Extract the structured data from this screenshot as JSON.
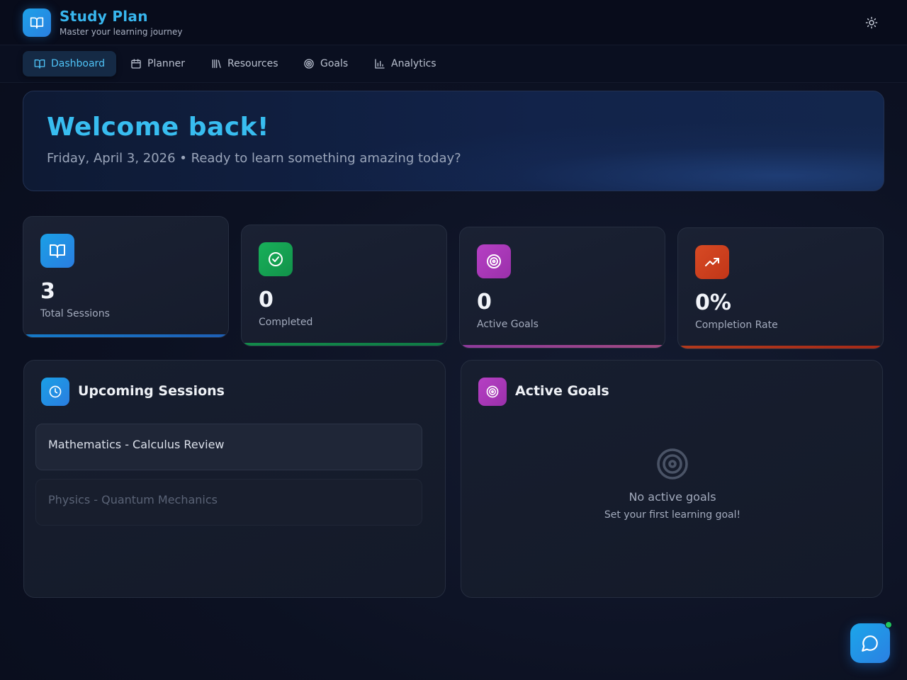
{
  "header": {
    "title": "Study Plan",
    "subtitle": "Master your learning journey",
    "logo_icon": "book-open-icon",
    "theme_icon": "sun-icon"
  },
  "nav": {
    "items": [
      {
        "label": "Dashboard",
        "icon": "book-open-icon",
        "active": true
      },
      {
        "label": "Planner",
        "icon": "calendar-icon",
        "active": false
      },
      {
        "label": "Resources",
        "icon": "library-icon",
        "active": false
      },
      {
        "label": "Goals",
        "icon": "target-icon",
        "active": false
      },
      {
        "label": "Analytics",
        "icon": "bar-chart-icon",
        "active": false
      }
    ]
  },
  "welcome": {
    "title": "Welcome back!",
    "subtitle": "Friday, April 3, 2026 • Ready to learn something amazing today?"
  },
  "stats": [
    {
      "value": "3",
      "label": "Total Sessions",
      "icon": "book-open-icon",
      "color": "#1e88e5"
    },
    {
      "value": "0",
      "label": "Completed",
      "icon": "check-circle-icon",
      "color": "#16a34a"
    },
    {
      "value": "0",
      "label": "Active Goals",
      "icon": "target-icon",
      "color": "#a93bb8"
    },
    {
      "value": "0%",
      "label": "Completion Rate",
      "icon": "trending-up-icon",
      "color": "#d2401f"
    }
  ],
  "upcoming": {
    "title": "Upcoming Sessions",
    "icon": "clock-icon",
    "sessions": [
      {
        "name": "Mathematics - Calculus Review"
      },
      {
        "name": "Physics - Quantum Mechanics"
      }
    ]
  },
  "goals": {
    "title": "Active Goals",
    "icon": "target-icon",
    "empty_title": "No active goals",
    "empty_subtitle": "Set your first learning goal!"
  },
  "chat": {
    "icon": "chat-bubble-icon",
    "status_color": "#22c55e"
  },
  "colors": {
    "accent": "#38b6ee",
    "background": "#0c1122"
  }
}
